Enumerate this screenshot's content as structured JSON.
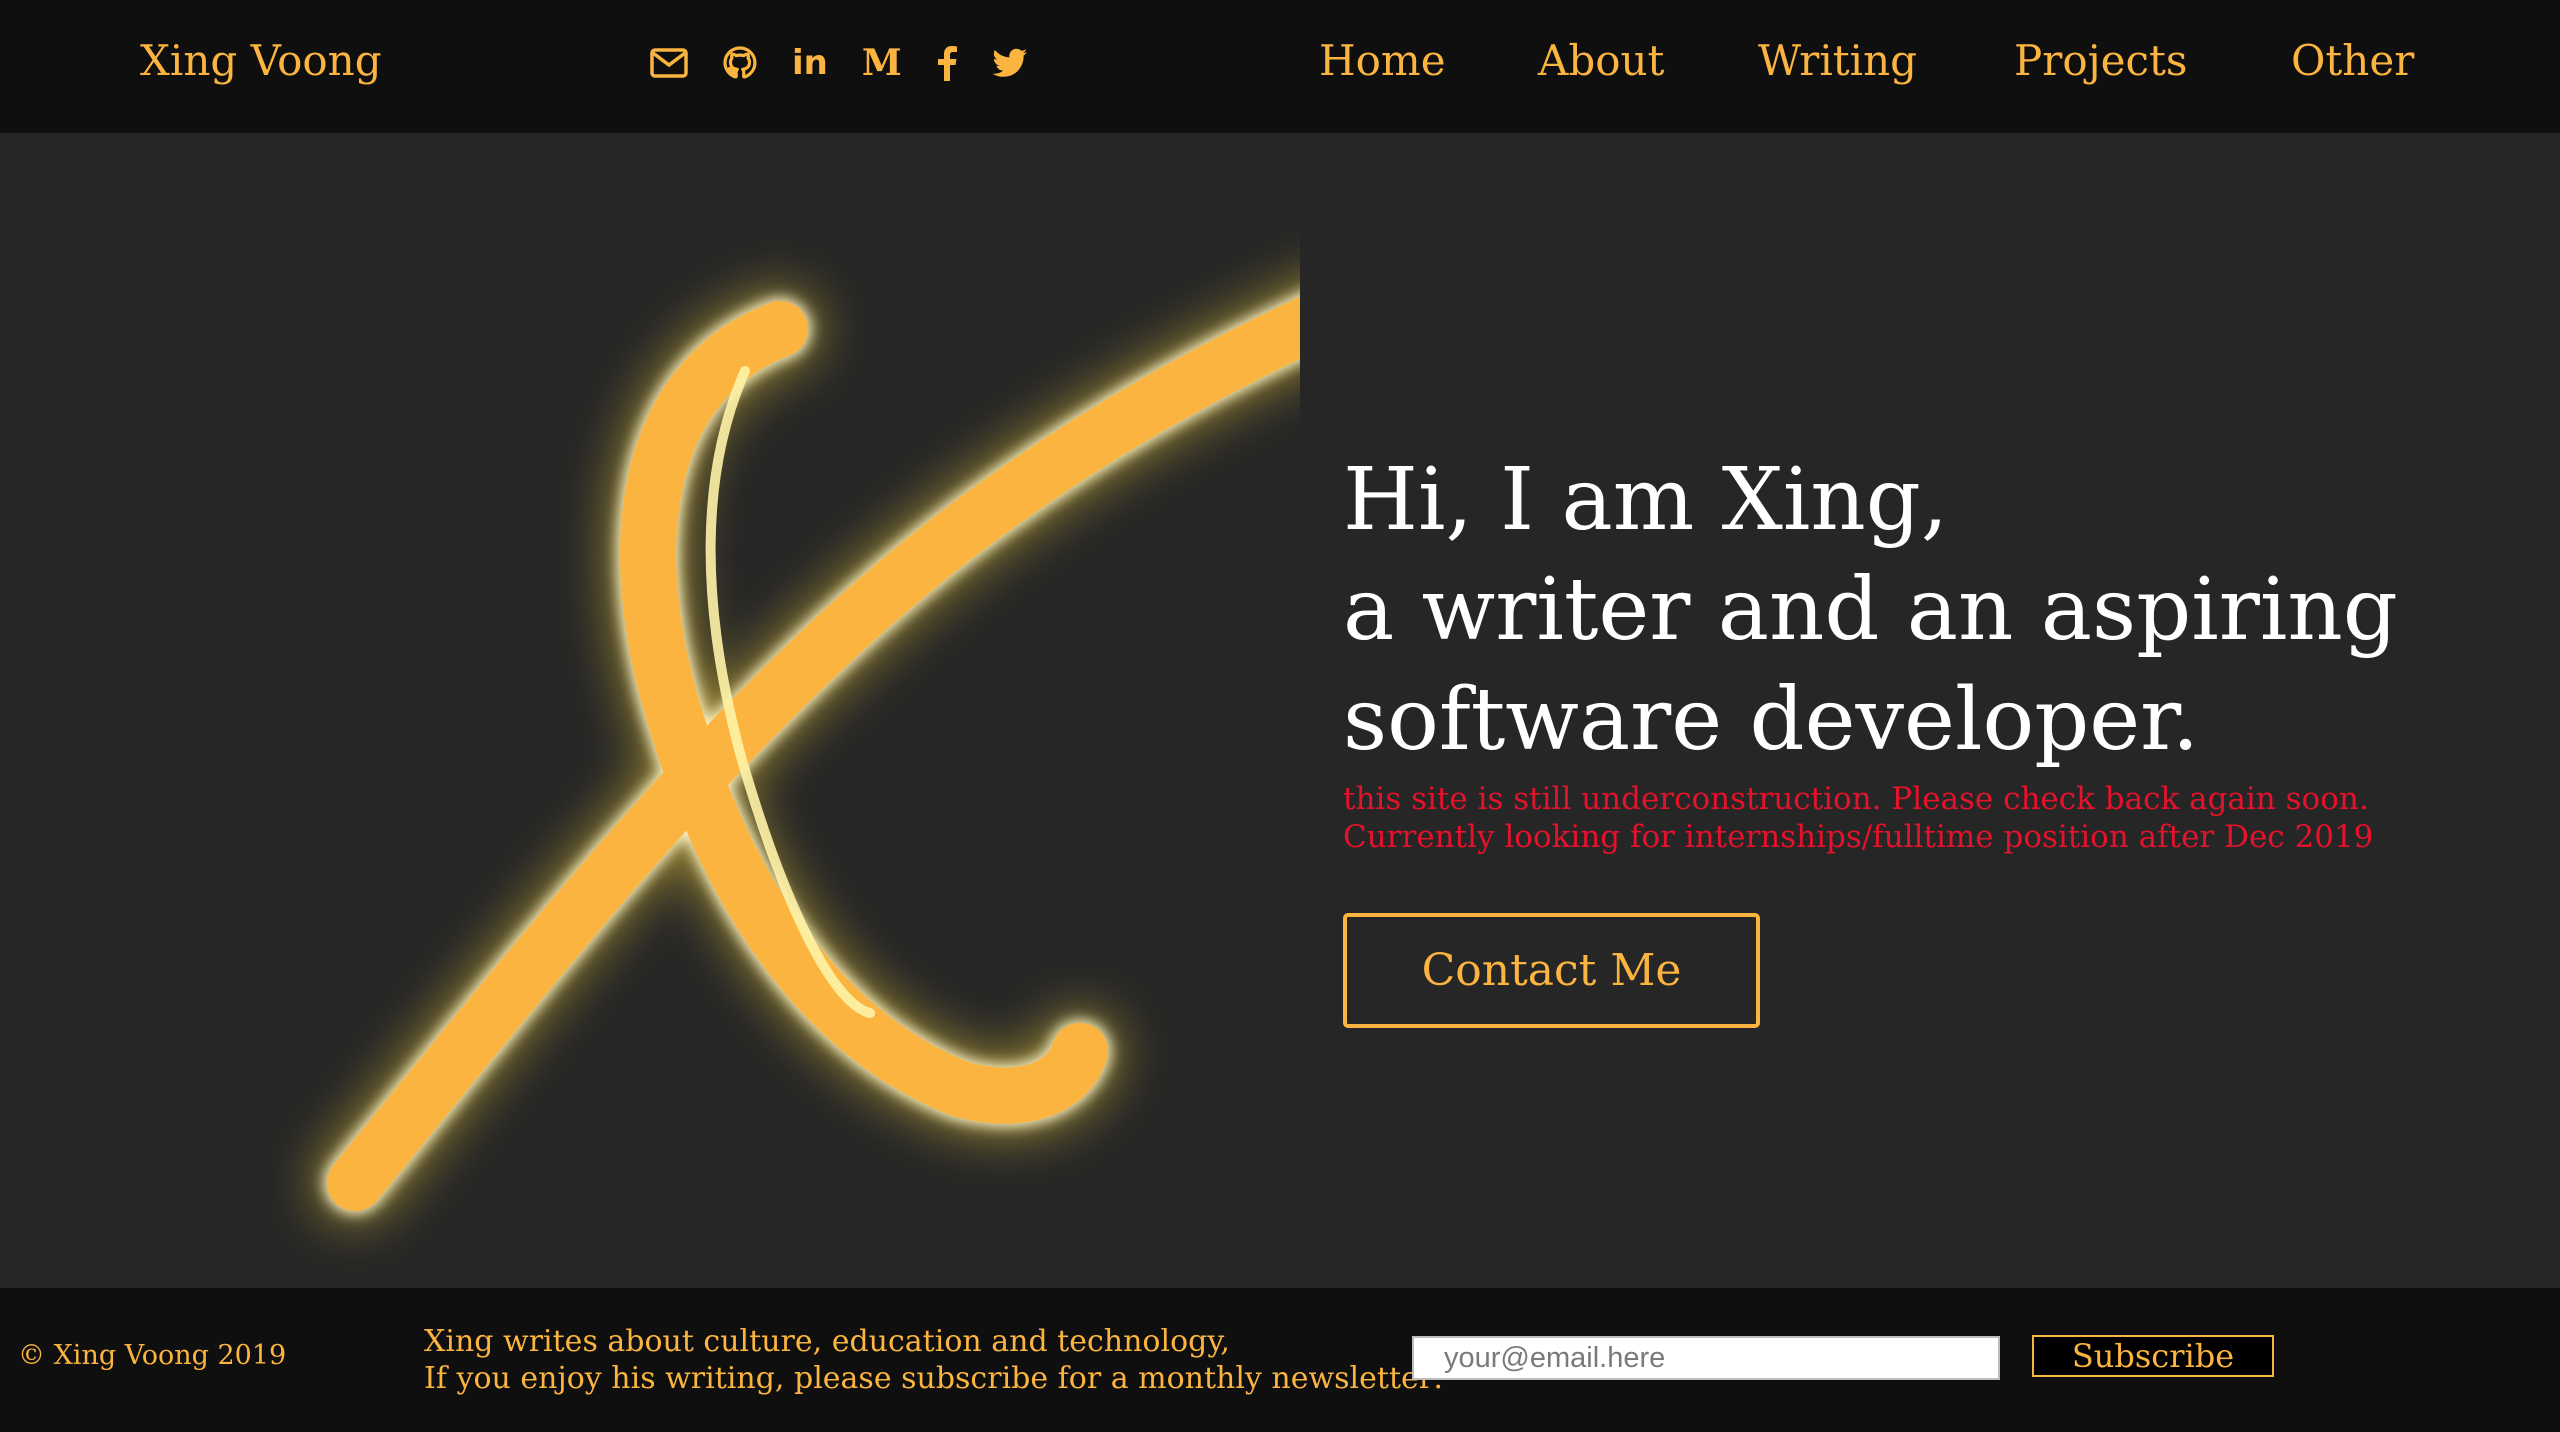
{
  "colors": {
    "accent": "#fbb43f",
    "navbar_bg": "#0f0f0f",
    "hero_bg": "#262626",
    "notice": "#e5122b",
    "headline": "#ffffff"
  },
  "navbar": {
    "brand": "Xing Voong",
    "social_icons": [
      "envelope-icon",
      "github-icon",
      "linkedin-icon",
      "medium-icon",
      "facebook-icon",
      "twitter-icon"
    ],
    "linkedin_text": "in",
    "medium_text": "M",
    "links": [
      "Home",
      "About",
      "Writing",
      "Projects",
      "Other"
    ]
  },
  "hero": {
    "logo_icon": "x-monogram-neon-logo",
    "headline": [
      "Hi, I am Xing,",
      "a writer and an aspiring",
      "software developer."
    ],
    "notice": "this site is still underconstruction. Please check back again soon. Currently looking for internships/fulltime position after Dec 2019",
    "contact_button": "Contact Me"
  },
  "footer": {
    "copyright": "© Xing Voong 2019",
    "blurb": [
      "Xing writes about culture, education and technology,",
      "If you enjoy his writing, please subscribe for a monthly newsletter:"
    ],
    "email_placeholder": "your@email.here",
    "subscribe_button": "Subscribe"
  }
}
